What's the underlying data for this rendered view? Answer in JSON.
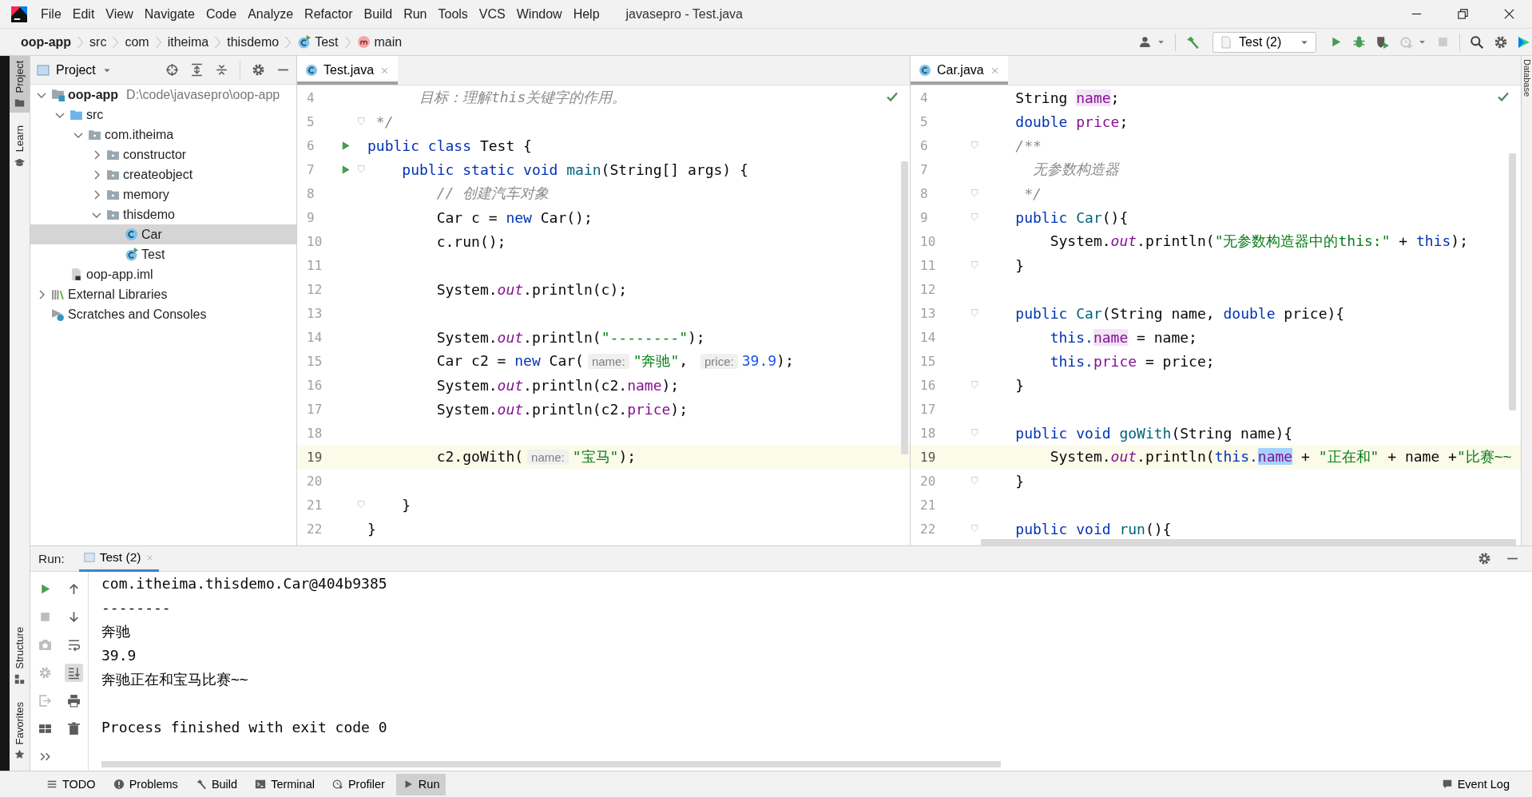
{
  "menu_bar": {
    "items": [
      "File",
      "Edit",
      "View",
      "Navigate",
      "Code",
      "Analyze",
      "Refactor",
      "Build",
      "Run",
      "Tools",
      "VCS",
      "Window",
      "Help"
    ],
    "title": "javasepro - Test.java"
  },
  "breadcrumbs": [
    {
      "label": "oop-app",
      "kind": "module"
    },
    {
      "label": "src",
      "kind": "plain"
    },
    {
      "label": "com",
      "kind": "plain"
    },
    {
      "label": "itheima",
      "kind": "plain"
    },
    {
      "label": "thisdemo",
      "kind": "plain"
    },
    {
      "label": "Test",
      "kind": "class"
    },
    {
      "label": "main",
      "kind": "method"
    }
  ],
  "toolbar": {
    "run_config": "Test (2)"
  },
  "left_stripe": {
    "top": [
      {
        "label": "Project",
        "kind": "project",
        "selected": true
      },
      {
        "label": "Learn",
        "kind": "learn",
        "selected": false
      }
    ],
    "bottom": [
      {
        "label": "Structure",
        "kind": "structure",
        "selected": false
      },
      {
        "label": "Favorites",
        "kind": "favorites",
        "selected": false
      }
    ]
  },
  "right_stripe": [
    {
      "label": "Database"
    }
  ],
  "project_panel": {
    "title": "Project",
    "tree": [
      {
        "label": "oop-app",
        "kind": "module",
        "detail": "D:\\code\\javasepro\\oop-app",
        "expanded": true,
        "selected": false,
        "children": [
          {
            "label": "src",
            "kind": "source",
            "expanded": true,
            "selected": false,
            "children": [
              {
                "label": "com.itheima",
                "kind": "package",
                "expanded": true,
                "selected": false,
                "children": [
                  {
                    "label": "constructor",
                    "kind": "package",
                    "expanded": false,
                    "selected": false
                  },
                  {
                    "label": "createobject",
                    "kind": "package",
                    "expanded": false,
                    "selected": false
                  },
                  {
                    "label": "memory",
                    "kind": "package",
                    "expanded": false,
                    "selected": false
                  },
                  {
                    "label": "thisdemo",
                    "kind": "package",
                    "expanded": true,
                    "selected": false,
                    "children": [
                      {
                        "label": "Car",
                        "kind": "class",
                        "selected": true
                      },
                      {
                        "label": "Test",
                        "kind": "test-class",
                        "selected": false
                      }
                    ]
                  }
                ]
              }
            ]
          },
          {
            "label": "oop-app.iml",
            "kind": "file",
            "selected": false
          }
        ]
      },
      {
        "label": "External Libraries",
        "kind": "libraries",
        "expanded": false,
        "selected": false
      },
      {
        "label": "Scratches and Consoles",
        "kind": "scratches",
        "selected": false
      }
    ]
  },
  "editors": [
    {
      "tab": {
        "label": "Test.java",
        "selected": true
      },
      "lines": [
        {
          "number": "4",
          "tokens": [
            {
              "text": "      目标：理解this关键字的作用。",
              "kind": "comment"
            }
          ]
        },
        {
          "number": "5",
          "fold": true,
          "tokens": [
            {
              "text": " */",
              "kind": "comment"
            }
          ]
        },
        {
          "number": "6",
          "run": true,
          "tokens": [
            {
              "text": "public class",
              "kind": "kw"
            },
            {
              "text": " Test {",
              "kind": "plain"
            }
          ]
        },
        {
          "number": "7",
          "run": true,
          "fold": true,
          "tokens": [
            {
              "text": "    public static void ",
              "kind": "kw"
            },
            {
              "text": "main",
              "kind": "decl"
            },
            {
              "text": "(String[] args) {",
              "kind": "plain"
            }
          ]
        },
        {
          "number": "8",
          "tokens": [
            {
              "text": "        // 创建汽车对象",
              "kind": "comment"
            }
          ]
        },
        {
          "number": "9",
          "tokens": [
            {
              "text": "        Car c = ",
              "kind": "plain"
            },
            {
              "text": "new",
              "kind": "kw"
            },
            {
              "text": " Car();",
              "kind": "plain"
            }
          ]
        },
        {
          "number": "10",
          "tokens": [
            {
              "text": "        c.run();",
              "kind": "plain"
            }
          ]
        },
        {
          "number": "11"
        },
        {
          "number": "12",
          "tokens": [
            {
              "text": "        System.",
              "kind": "plain"
            },
            {
              "text": "out",
              "kind": "static"
            },
            {
              "text": ".println(c);",
              "kind": "plain"
            }
          ]
        },
        {
          "number": "13"
        },
        {
          "number": "14",
          "tokens": [
            {
              "text": "        System.",
              "kind": "plain"
            },
            {
              "text": "out",
              "kind": "static"
            },
            {
              "text": ".println(",
              "kind": "plain"
            },
            {
              "text": "\"--------\"",
              "kind": "string"
            },
            {
              "text": ");",
              "kind": "plain"
            }
          ]
        },
        {
          "number": "15",
          "tokens": [
            {
              "text": "        Car c2 = ",
              "kind": "plain"
            },
            {
              "text": "new",
              "kind": "kw"
            },
            {
              "text": " Car(",
              "kind": "plain"
            },
            {
              "text": "name:",
              "kind": "hint"
            },
            {
              "text": "\"奔驰\"",
              "kind": "string"
            },
            {
              "text": ", ",
              "kind": "plain"
            },
            {
              "text": "price:",
              "kind": "hint"
            },
            {
              "text": "39.9",
              "kind": "number"
            },
            {
              "text": ");",
              "kind": "plain"
            }
          ]
        },
        {
          "number": "16",
          "tokens": [
            {
              "text": "        System.",
              "kind": "plain"
            },
            {
              "text": "out",
              "kind": "static"
            },
            {
              "text": ".println(c2.",
              "kind": "plain"
            },
            {
              "text": "name",
              "kind": "field"
            },
            {
              "text": ");",
              "kind": "plain"
            }
          ]
        },
        {
          "number": "17",
          "tokens": [
            {
              "text": "        System.",
              "kind": "plain"
            },
            {
              "text": "out",
              "kind": "static"
            },
            {
              "text": ".println(c2.",
              "kind": "plain"
            },
            {
              "text": "price",
              "kind": "field"
            },
            {
              "text": ");",
              "kind": "plain"
            }
          ]
        },
        {
          "number": "18"
        },
        {
          "number": "19",
          "current": true,
          "tokens": [
            {
              "text": "        c2.goWith(",
              "kind": "plain"
            },
            {
              "text": "name:",
              "kind": "hint"
            },
            {
              "text": "\"宝马\"",
              "kind": "string"
            },
            {
              "text": ");",
              "kind": "plain"
            }
          ]
        },
        {
          "number": "20"
        },
        {
          "number": "21",
          "fold": true,
          "tokens": [
            {
              "text": "    }",
              "kind": "plain"
            }
          ]
        },
        {
          "number": "22",
          "tokens": [
            {
              "text": "}",
              "kind": "plain"
            }
          ]
        }
      ]
    },
    {
      "tab": {
        "label": "Car.java",
        "selected": true
      },
      "lines": [
        {
          "number": "4",
          "tokens": [
            {
              "text": "    String ",
              "kind": "plain"
            },
            {
              "text": "name",
              "kind": "field",
              "highlighted": true
            },
            {
              "text": ";",
              "kind": "plain"
            }
          ]
        },
        {
          "number": "5",
          "tokens": [
            {
              "text": "    double ",
              "kind": "kw"
            },
            {
              "text": "price",
              "kind": "field"
            },
            {
              "text": ";",
              "kind": "plain"
            }
          ]
        },
        {
          "number": "6",
          "fold": true,
          "tokens": [
            {
              "text": "    /**",
              "kind": "comment"
            }
          ]
        },
        {
          "number": "7",
          "tokens": [
            {
              "text": "      无参数构造器",
              "kind": "comment"
            }
          ]
        },
        {
          "number": "8",
          "fold": true,
          "tokens": [
            {
              "text": "     */",
              "kind": "comment"
            }
          ]
        },
        {
          "number": "9",
          "fold": true,
          "tokens": [
            {
              "text": "    public ",
              "kind": "kw"
            },
            {
              "text": "Car",
              "kind": "decl"
            },
            {
              "text": "(){",
              "kind": "plain"
            }
          ]
        },
        {
          "number": "10",
          "tokens": [
            {
              "text": "        System.",
              "kind": "plain"
            },
            {
              "text": "out",
              "kind": "static"
            },
            {
              "text": ".println(",
              "kind": "plain"
            },
            {
              "text": "\"无参数构造器中的this:\"",
              "kind": "string"
            },
            {
              "text": " + ",
              "kind": "plain"
            },
            {
              "text": "this",
              "kind": "kw"
            },
            {
              "text": ");",
              "kind": "plain"
            }
          ]
        },
        {
          "number": "11",
          "fold": true,
          "tokens": [
            {
              "text": "    }",
              "kind": "plain"
            }
          ]
        },
        {
          "number": "12"
        },
        {
          "number": "13",
          "fold": true,
          "tokens": [
            {
              "text": "    public ",
              "kind": "kw"
            },
            {
              "text": "Car",
              "kind": "decl"
            },
            {
              "text": "(String name, ",
              "kind": "plain"
            },
            {
              "text": "double",
              "kind": "kw"
            },
            {
              "text": " price){",
              "kind": "plain"
            }
          ]
        },
        {
          "number": "14",
          "tokens": [
            {
              "text": "        this.",
              "kind": "kw"
            },
            {
              "text": "name",
              "kind": "field",
              "highlighted": true
            },
            {
              "text": " = name;",
              "kind": "plain"
            }
          ]
        },
        {
          "number": "15",
          "tokens": [
            {
              "text": "        this.",
              "kind": "kw"
            },
            {
              "text": "price",
              "kind": "field"
            },
            {
              "text": " = price;",
              "kind": "plain"
            }
          ]
        },
        {
          "number": "16",
          "fold": true,
          "tokens": [
            {
              "text": "    }",
              "kind": "plain"
            }
          ]
        },
        {
          "number": "17"
        },
        {
          "number": "18",
          "fold": true,
          "tokens": [
            {
              "text": "    public void ",
              "kind": "kw"
            },
            {
              "text": "goWith",
              "kind": "decl"
            },
            {
              "text": "(String name){",
              "kind": "plain"
            }
          ]
        },
        {
          "number": "19",
          "current": true,
          "tokens": [
            {
              "text": "        System.",
              "kind": "plain"
            },
            {
              "text": "out",
              "kind": "static"
            },
            {
              "text": ".println(",
              "kind": "plain"
            },
            {
              "text": "this.",
              "kind": "kw"
            },
            {
              "text": "name",
              "kind": "field",
              "selected": true
            },
            {
              "text": " + ",
              "kind": "plain"
            },
            {
              "text": "\"正在和\"",
              "kind": "string"
            },
            {
              "text": " + name +",
              "kind": "plain"
            },
            {
              "text": "\"比赛~~",
              "kind": "string"
            }
          ]
        },
        {
          "number": "20",
          "fold": true,
          "tokens": [
            {
              "text": "    }",
              "kind": "plain"
            }
          ]
        },
        {
          "number": "21"
        },
        {
          "number": "22",
          "fold": true,
          "tokens": [
            {
              "text": "    public void ",
              "kind": "kw"
            },
            {
              "text": "run",
              "kind": "decl"
            },
            {
              "text": "(){",
              "kind": "plain"
            }
          ]
        }
      ]
    }
  ],
  "run_panel": {
    "label": "Run:",
    "tabs": [
      {
        "label": "Test (2)",
        "selected": true
      }
    ],
    "output": [
      {
        "text": "com.itheima.thisdemo.Car@404b9385"
      },
      {
        "text": "--------"
      },
      {
        "text": "奔驰"
      },
      {
        "text": "39.9"
      },
      {
        "text": "奔驰正在和宝马比赛~~"
      },
      {
        "text": "Process finished with exit code 0",
        "blank_before": true
      }
    ]
  },
  "status_bar": {
    "tabs": [
      {
        "label": "TODO",
        "kind": "todo",
        "selected": false
      },
      {
        "label": "Problems",
        "kind": "problems",
        "selected": false
      },
      {
        "label": "Build",
        "kind": "build",
        "selected": false
      },
      {
        "label": "Terminal",
        "kind": "terminal",
        "selected": false
      },
      {
        "label": "Profiler",
        "kind": "profiler",
        "selected": false
      },
      {
        "label": "Run",
        "kind": "run",
        "selected": true
      }
    ],
    "event_log": "Event Log"
  }
}
